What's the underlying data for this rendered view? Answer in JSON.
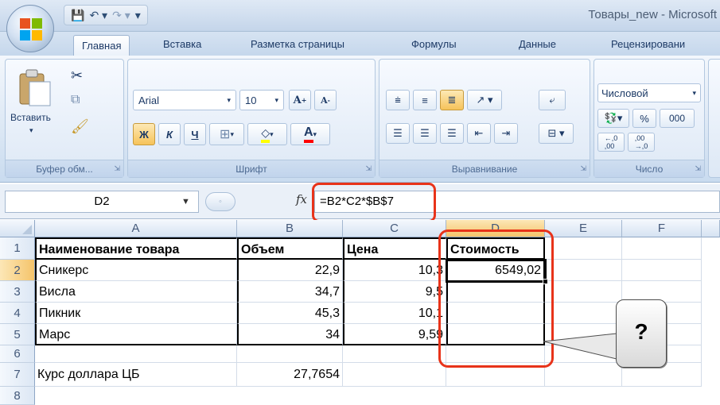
{
  "window": {
    "title": "Товары_new - Microsoft"
  },
  "tabs": [
    {
      "label": "Главная",
      "active": true
    },
    {
      "label": "Вставка"
    },
    {
      "label": "Разметка страницы"
    },
    {
      "label": "Формулы"
    },
    {
      "label": "Данные"
    },
    {
      "label": "Рецензировани"
    }
  ],
  "ribbon": {
    "clipboard": {
      "paste_label": "Вставить",
      "group_label": "Буфер обм..."
    },
    "font": {
      "font_name": "Arial",
      "font_size": "10",
      "grow_label": "A",
      "shrink_label": "A",
      "bold": "Ж",
      "italic": "К",
      "underline": "Ч",
      "fill_color": "#ffff00",
      "font_color": "#ff0000",
      "group_label": "Шрифт"
    },
    "alignment": {
      "group_label": "Выравнивание"
    },
    "number": {
      "format": "Числовой",
      "percent": "%",
      "thousands": "000",
      "inc_decimal": "⁺,0 ,00",
      "dec_decimal": ",00 ,0",
      "group_label": "Число"
    }
  },
  "formula_bar": {
    "name_box": "D2",
    "fx": "fx",
    "formula": "=B2*C2*$B$7"
  },
  "sheet": {
    "columns": [
      "A",
      "B",
      "C",
      "D",
      "E",
      "F"
    ],
    "rows": [
      "1",
      "2",
      "3",
      "4",
      "5",
      "6",
      "7",
      "8"
    ],
    "cells": {
      "A1": "Наименование товара",
      "B1": "Объем",
      "C1": "Цена",
      "D1": "Стоимость",
      "A2": "Сникерс",
      "B2": "22,9",
      "C2": "10,3",
      "D2": "6549,02",
      "A3": "Висла",
      "B3": "34,7",
      "C3": "9,5",
      "A4": "Пикник",
      "B4": "45,3",
      "C4": "10,1",
      "A5": "Марс",
      "B5": "34",
      "C5": "9,59",
      "A7": "Курс доллара ЦБ",
      "B7": "27,7654"
    }
  },
  "callout": {
    "text": "?"
  },
  "colors": {
    "highlight": "#e8331a",
    "selected_header": "#f5c46b"
  }
}
